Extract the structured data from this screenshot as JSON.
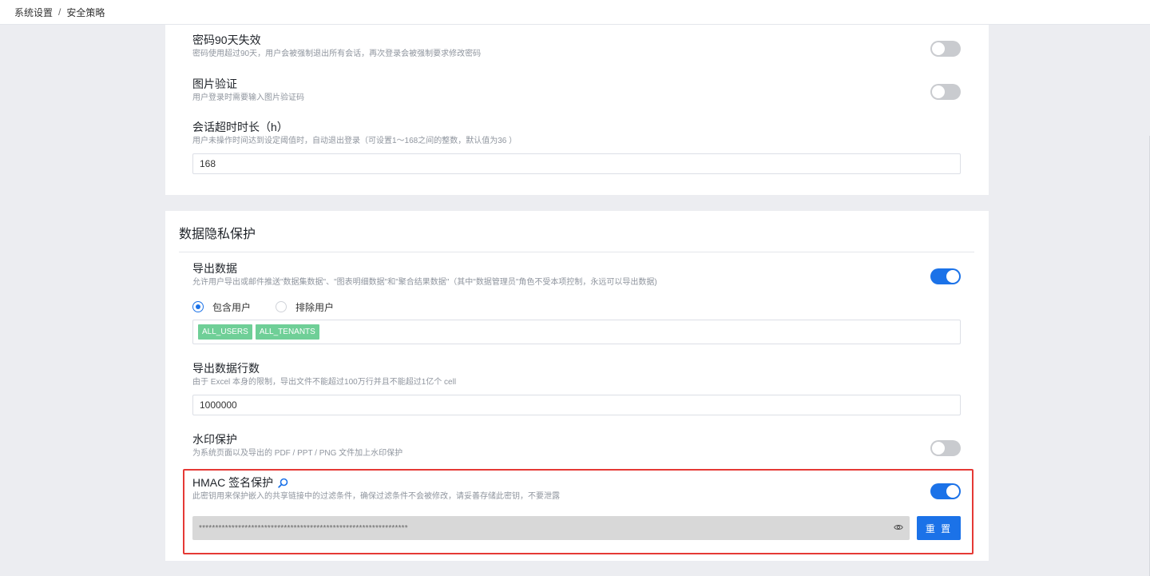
{
  "breadcrumb": {
    "parent": "系统设置",
    "separator": "/",
    "current": "安全策略"
  },
  "password_expiry": {
    "title": "密码90天失效",
    "desc": "密码使用超过90天，用户会被强制退出所有会话，再次登录会被强制要求修改密码",
    "enabled": false
  },
  "captcha": {
    "title": "图片验证",
    "desc": "用户登录时需要输入图片验证码",
    "enabled": false
  },
  "session_timeout": {
    "title": "会话超时时长（h）",
    "desc": "用户未操作时间达到设定阈值时，自动退出登录（可设置1～168之间的整数，默认值为36 ）",
    "value": "168"
  },
  "privacy_section": {
    "title": "数据隐私保护"
  },
  "export_data": {
    "title": "导出数据",
    "desc": "允许用户导出或邮件推送\"数据集数据\"、\"图表明细数据\"和\"聚合结果数据\"（其中\"数据管理员\"角色不受本项控制，永远可以导出数据)",
    "enabled": true,
    "radio_include": "包含用户",
    "radio_exclude": "排除用户",
    "selected": "include",
    "tags": [
      "ALL_USERS",
      "ALL_TENANTS"
    ]
  },
  "export_rows": {
    "title": "导出数据行数",
    "desc": "由于 Excel 本身的限制，导出文件不能超过100万行并且不能超过1亿个 cell",
    "value": "1000000"
  },
  "watermark": {
    "title": "水印保护",
    "desc": "为系统页面以及导出的 PDF / PPT / PNG 文件加上水印保护",
    "enabled": false
  },
  "hmac": {
    "title": "HMAC 签名保护",
    "desc": "此密钥用来保护嵌入的共享链接中的过滤条件，确保过滤条件不会被修改，请妥善存储此密钥，不要泄露",
    "enabled": true,
    "secret": "****************************************************************",
    "reset_label": "重 置"
  },
  "colors": {
    "accent": "#1b72e8",
    "tag_green": "#6fcf97",
    "highlight_red": "#e53935",
    "toggle_off": "#c9cbcf"
  },
  "icons": {
    "hmac_help": "search-icon",
    "secret_visibility": "eye-icon"
  }
}
